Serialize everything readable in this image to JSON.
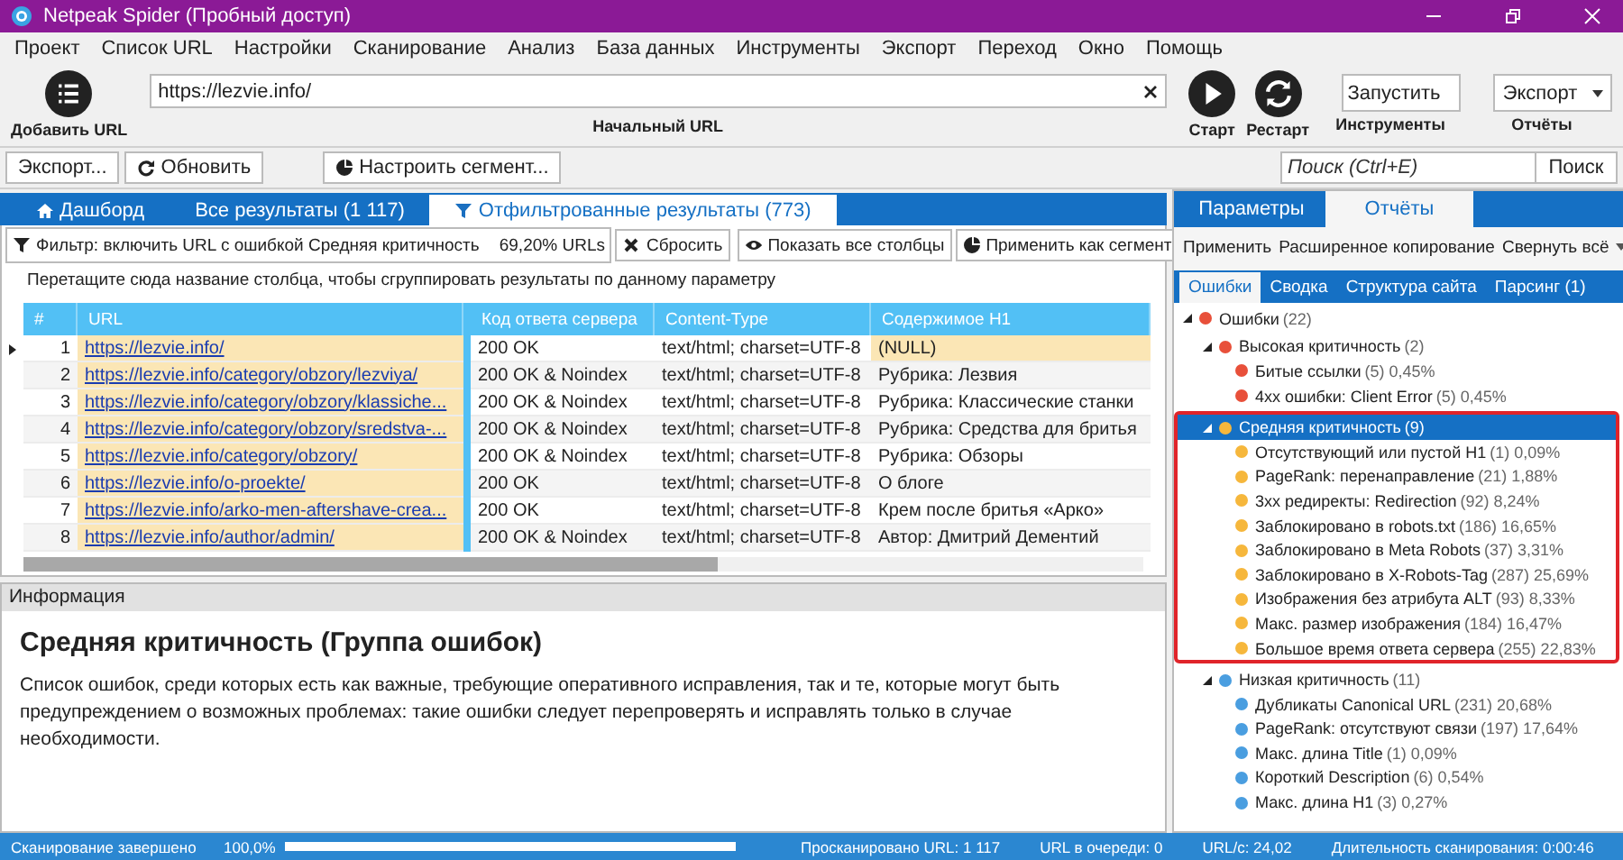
{
  "window": {
    "title": "Netpeak Spider (Пробный доступ)"
  },
  "menu": [
    "Проект",
    "Список URL",
    "Настройки",
    "Сканирование",
    "Анализ",
    "База данных",
    "Инструменты",
    "Экспорт",
    "Переход",
    "Окно",
    "Помощь"
  ],
  "toolbar": {
    "add_url": "Добавить URL",
    "url_field": {
      "value": "https://lezvie.info/",
      "label": "Начальный URL"
    },
    "start": "Старт",
    "restart": "Рестарт",
    "tools": {
      "value": "Запустить",
      "label": "Инструменты"
    },
    "reports": {
      "value": "Экспорт",
      "label": "Отчёты"
    }
  },
  "actions": {
    "export": "Экспорт...",
    "refresh": "Обновить",
    "segment": "Настроить сегмент...",
    "search": {
      "placeholder": "Поиск (Ctrl+E)"
    },
    "search_button": "Поиск"
  },
  "results_tabs": [
    {
      "label": "Дашборд",
      "kind": "dashboard",
      "selected": false
    },
    {
      "label": "Все результаты (1 117)",
      "kind": "plain",
      "selected": false
    },
    {
      "label": "Отфильтрованные результаты (773)",
      "kind": "filter",
      "selected": true
    }
  ],
  "filter_bar": {
    "filter": "Фильтр: включить URL с ошибкой Средняя критичность",
    "share": "69,20% URLs",
    "reset": "Сбросить",
    "show_columns": "Показать все столбцы",
    "apply_segment": "Применить как сегмент"
  },
  "table": {
    "group_hint": "Перетащите сюда название столбца, чтобы сгруппировать результаты по данному параметру",
    "columns": [
      "#",
      "URL",
      "Код ответа сервера",
      "Content-Type",
      "Содержимое H1"
    ],
    "rows": [
      {
        "num": "1",
        "url": "https://lezvie.info/",
        "status": "200 OK",
        "content_type": "text/html; charset=UTF-8",
        "h1": "(NULL)",
        "selected": true
      },
      {
        "num": "2",
        "url": "https://lezvie.info/category/obzory/lezviya/",
        "status": "200 OK & Noindex",
        "content_type": "text/html; charset=UTF-8",
        "h1": "Рубрика: Лезвия",
        "selected": false
      },
      {
        "num": "3",
        "url": "https://lezvie.info/category/obzory/klassiche...",
        "status": "200 OK & Noindex",
        "content_type": "text/html; charset=UTF-8",
        "h1": "Рубрика: Классические станки",
        "selected": false
      },
      {
        "num": "4",
        "url": "https://lezvie.info/category/obzory/sredstva-...",
        "status": "200 OK & Noindex",
        "content_type": "text/html; charset=UTF-8",
        "h1": "Рубрика: Средства для бритья",
        "selected": false
      },
      {
        "num": "5",
        "url": "https://lezvie.info/category/obzory/",
        "status": "200 OK & Noindex",
        "content_type": "text/html; charset=UTF-8",
        "h1": "Рубрика: Обзоры",
        "selected": false
      },
      {
        "num": "6",
        "url": "https://lezvie.info/o-proekte/",
        "status": "200 OK",
        "content_type": "text/html; charset=UTF-8",
        "h1": "О блоге",
        "selected": false
      },
      {
        "num": "7",
        "url": "https://lezvie.info/arko-men-aftershave-crea...",
        "status": "200 OK",
        "content_type": "text/html; charset=UTF-8",
        "h1": "Крем после бритья «Арко»",
        "selected": false
      },
      {
        "num": "8",
        "url": "https://lezvie.info/author/admin/",
        "status": "200 OK & Noindex",
        "content_type": "text/html; charset=UTF-8",
        "h1": "Автор: Дмитрий Дементий",
        "selected": false
      }
    ]
  },
  "info": {
    "header": "Информация",
    "title": "Средняя критичность (Группа ошибок)",
    "text": "Список ошибок, среди которых есть как важные, требующие оперативного исправления, так и те, которые могут быть предупреждением о возможных проблемах: такие ошибки следует перепроверять и исправлять только в случае необходимости."
  },
  "side_tabs": [
    {
      "label": "Параметры",
      "selected": false
    },
    {
      "label": "Отчёты",
      "selected": true
    }
  ],
  "report_actions": [
    "Применить",
    "Расширенное копирование",
    "Свернуть всё"
  ],
  "report_tabs": [
    {
      "label": "Ошибки",
      "selected": true
    },
    {
      "label": "Сводка",
      "selected": false
    },
    {
      "label": "Структура сайта",
      "selected": false
    },
    {
      "label": "Парсинг (1)",
      "selected": false
    }
  ],
  "tree": [
    {
      "label": "Ошибки",
      "stats": "(22)",
      "color": "#e8503a",
      "expanded": true,
      "selected": false,
      "children": [
        {
          "label": "Высокая критичность",
          "stats": "(2)",
          "color": "#e8503a",
          "expanded": true,
          "selected": false,
          "highlighted": false,
          "children": [
            {
              "label": "Битые ссылки",
              "stats": "(5) 0,45%",
              "color": "#e8503a",
              "selected": false
            },
            {
              "label": "4xx ошибки: Client Error",
              "stats": "(5) 0,45%",
              "color": "#e8503a",
              "selected": false
            }
          ]
        },
        {
          "label": "Средняя критичность",
          "stats": "(9)",
          "color": "#f6b73c",
          "expanded": true,
          "selected": true,
          "highlighted": true,
          "children": [
            {
              "label": "Отсутствующий или пустой H1",
              "stats": "(1) 0,09%",
              "color": "#f6b73c",
              "selected": false
            },
            {
              "label": "PageRank: перенаправление",
              "stats": "(21) 1,88%",
              "color": "#f6b73c",
              "selected": false
            },
            {
              "label": "3xx редиректы: Redirection",
              "stats": "(92) 8,24%",
              "color": "#f6b73c",
              "selected": false
            },
            {
              "label": "Заблокировано в robots.txt",
              "stats": "(186) 16,65%",
              "color": "#f6b73c",
              "selected": false
            },
            {
              "label": "Заблокировано в Meta Robots",
              "stats": "(37) 3,31%",
              "color": "#f6b73c",
              "selected": false
            },
            {
              "label": "Заблокировано в X-Robots-Tag",
              "stats": "(287) 25,69%",
              "color": "#f6b73c",
              "selected": false
            },
            {
              "label": "Изображения без атрибута ALT",
              "stats": "(93) 8,33%",
              "color": "#f6b73c",
              "selected": false
            },
            {
              "label": "Макс. размер изображения",
              "stats": "(184) 16,47%",
              "color": "#f6b73c",
              "selected": false
            },
            {
              "label": "Большое время ответа сервера",
              "stats": "(255) 22,83%",
              "color": "#f6b73c",
              "selected": false
            }
          ]
        },
        {
          "label": "Низкая критичность",
          "stats": "(11)",
          "color": "#4a9ee0",
          "expanded": true,
          "selected": false,
          "highlighted": false,
          "children": [
            {
              "label": "Дубликаты Canonical URL",
              "stats": "(231) 20,68%",
              "color": "#4a9ee0",
              "selected": false
            },
            {
              "label": "PageRank: отсутствуют связи",
              "stats": "(197) 17,64%",
              "color": "#4a9ee0",
              "selected": false
            },
            {
              "label": "Макс. длина Title",
              "stats": "(1) 0,09%",
              "color": "#4a9ee0",
              "selected": false
            },
            {
              "label": "Короткий Description",
              "stats": "(6) 0,54%",
              "color": "#4a9ee0",
              "selected": false
            },
            {
              "label": "Макс. длина H1",
              "stats": "(3) 0,27%",
              "color": "#4a9ee0",
              "selected": false
            }
          ]
        }
      ]
    }
  ],
  "status_bar": {
    "state": "Сканирование завершено",
    "percent": "100,0%",
    "level": 1,
    "scanned": "Просканировано URL: 1 117",
    "queue": "URL в очереди: 0",
    "speed": "URL/с: 24,02",
    "duration": "Длительность сканирования: 0:00:46"
  }
}
